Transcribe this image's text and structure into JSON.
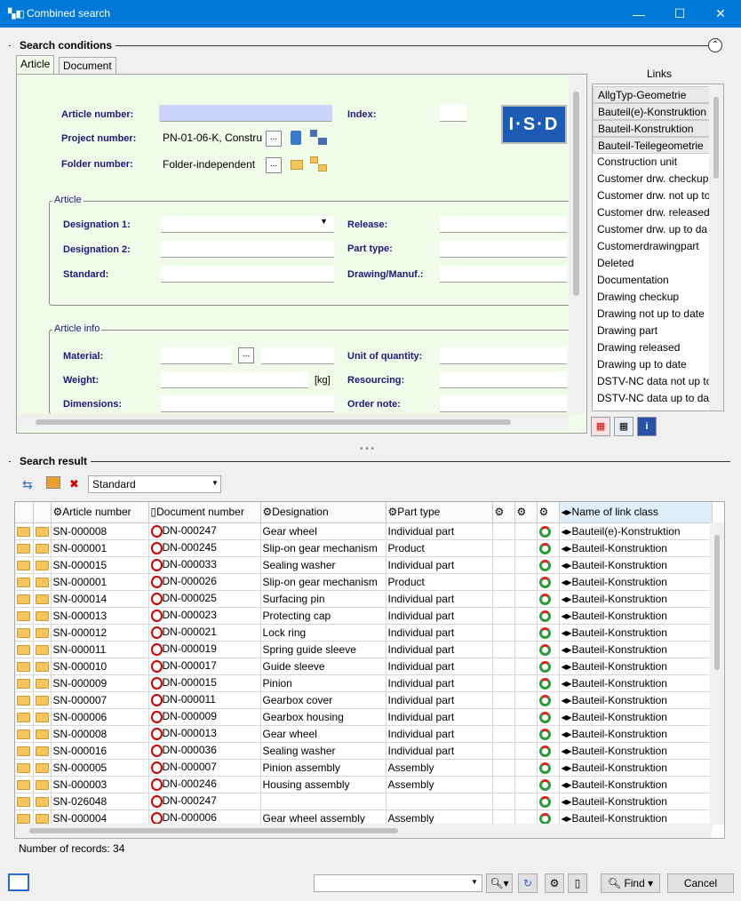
{
  "window": {
    "title": "Combined search",
    "app_icon": "isd-app-icon"
  },
  "search_conditions": {
    "title": "Search conditions",
    "tabs": [
      "Article",
      "Document"
    ],
    "article_number": {
      "label": "Article number:",
      "value": ""
    },
    "index": {
      "label": "Index:",
      "value": ""
    },
    "project_number": {
      "label": "Project number:",
      "value": "PN-01-06-K, Constru"
    },
    "folder_number": {
      "label": "Folder number:",
      "value": "Folder-independent"
    },
    "browse_label": "...",
    "logo_text": "I·S·D",
    "article_group": {
      "title": "Article",
      "designation1": {
        "label": "Designation 1:",
        "value": ""
      },
      "designation2": {
        "label": "Designation 2:",
        "value": ""
      },
      "standard": {
        "label": "Standard:",
        "value": ""
      },
      "release": {
        "label": "Release:",
        "value": ""
      },
      "part_type": {
        "label": "Part type:",
        "value": ""
      },
      "drawing_manuf": {
        "label": "Drawing/Manuf.:",
        "value": ""
      }
    },
    "article_info_group": {
      "title": "Article info",
      "material": {
        "label": "Material:",
        "value": ""
      },
      "weight": {
        "label": "Weight:",
        "value": "",
        "unit": "[kg]"
      },
      "dimensions": {
        "label": "Dimensions:",
        "value": ""
      },
      "unit_of_quantity": {
        "label": "Unit of quantity:",
        "value": ""
      },
      "resourcing": {
        "label": "Resourcing:",
        "value": ""
      },
      "order_note": {
        "label": "Order note:",
        "value": ""
      }
    }
  },
  "links": {
    "title": "Links",
    "items": [
      {
        "label": "AllgTyp-Geometrie",
        "selected": true
      },
      {
        "label": "Bauteil(e)-Konstruktion",
        "selected": true
      },
      {
        "label": "Bauteil-Konstruktion",
        "selected": true
      },
      {
        "label": "Bauteil-Teilegeometrie",
        "selected": true
      },
      {
        "label": "Construction unit",
        "selected": false
      },
      {
        "label": "Customer drw. checkup",
        "selected": false
      },
      {
        "label": "Customer drw. not up to",
        "selected": false
      },
      {
        "label": "Customer drw. released",
        "selected": false
      },
      {
        "label": "Customer drw. up to da",
        "selected": false
      },
      {
        "label": "Customerdrawingpart",
        "selected": false
      },
      {
        "label": "Deleted",
        "selected": false
      },
      {
        "label": "Documentation",
        "selected": false
      },
      {
        "label": "Drawing checkup",
        "selected": false
      },
      {
        "label": "Drawing not up to date",
        "selected": false
      },
      {
        "label": "Drawing part",
        "selected": false
      },
      {
        "label": "Drawing released",
        "selected": false
      },
      {
        "label": "Drawing up to date",
        "selected": false
      },
      {
        "label": "DSTV-NC data not up to",
        "selected": false
      },
      {
        "label": "DSTV-NC data up to dat",
        "selected": false
      }
    ]
  },
  "search_result": {
    "title": "Search result",
    "profile": "Standard",
    "columns": [
      "Article number",
      "Document number",
      "Designation",
      "Part type",
      "",
      "",
      "",
      "Name of link class"
    ],
    "rows": [
      {
        "article": "SN-000008",
        "document": "DN-000247",
        "designation": "Gear wheel",
        "part_type": "Individual part",
        "link": "Bauteil(e)-Konstruktion"
      },
      {
        "article": "SN-000001",
        "document": "DN-000245",
        "designation": "Slip-on gear mechanism",
        "part_type": "Product",
        "link": "Bauteil-Konstruktion"
      },
      {
        "article": "SN-000015",
        "document": "DN-000033",
        "designation": "Sealing washer",
        "part_type": "Individual part",
        "link": "Bauteil-Konstruktion"
      },
      {
        "article": "SN-000001",
        "document": "DN-000026",
        "designation": "Slip-on gear mechanism",
        "part_type": "Product",
        "link": "Bauteil-Konstruktion"
      },
      {
        "article": "SN-000014",
        "document": "DN-000025",
        "designation": "Surfacing pin",
        "part_type": "Individual part",
        "link": "Bauteil-Konstruktion"
      },
      {
        "article": "SN-000013",
        "document": "DN-000023",
        "designation": "Protecting cap",
        "part_type": "Individual part",
        "link": "Bauteil-Konstruktion"
      },
      {
        "article": "SN-000012",
        "document": "DN-000021",
        "designation": "Lock ring",
        "part_type": "Individual part",
        "link": "Bauteil-Konstruktion"
      },
      {
        "article": "SN-000011",
        "document": "DN-000019",
        "designation": "Spring guide sleeve",
        "part_type": "Individual part",
        "link": "Bauteil-Konstruktion"
      },
      {
        "article": "SN-000010",
        "document": "DN-000017",
        "designation": "Guide sleeve",
        "part_type": "Individual part",
        "link": "Bauteil-Konstruktion"
      },
      {
        "article": "SN-000009",
        "document": "DN-000015",
        "designation": "Pinion",
        "part_type": "Individual part",
        "link": "Bauteil-Konstruktion"
      },
      {
        "article": "SN-000007",
        "document": "DN-000011",
        "designation": "Gearbox cover",
        "part_type": "Individual part",
        "link": "Bauteil-Konstruktion"
      },
      {
        "article": "SN-000006",
        "document": "DN-000009",
        "designation": "Gearbox housing",
        "part_type": "Individual part",
        "link": "Bauteil-Konstruktion"
      },
      {
        "article": "SN-000008",
        "document": "DN-000013",
        "designation": "Gear wheel",
        "part_type": "Individual part",
        "link": "Bauteil-Konstruktion"
      },
      {
        "article": "SN-000016",
        "document": "DN-000036",
        "designation": "Sealing washer",
        "part_type": "Individual part",
        "link": "Bauteil-Konstruktion"
      },
      {
        "article": "SN-000005",
        "document": "DN-000007",
        "designation": "Pinion assembly",
        "part_type": "Assembly",
        "link": "Bauteil-Konstruktion"
      },
      {
        "article": "SN-000003",
        "document": "DN-000246",
        "designation": "Housing assembly",
        "part_type": "Assembly",
        "link": "Bauteil-Konstruktion"
      },
      {
        "article": "SN-026048",
        "document": "DN-000247",
        "designation": "",
        "part_type": "",
        "link": "Bauteil-Konstruktion"
      },
      {
        "article": "SN-000004",
        "document": "DN-000006",
        "designation": "Gear wheel assembly",
        "part_type": "Assembly",
        "link": "Bauteil-Konstruktion"
      }
    ],
    "record_count": "Number of records: 34"
  },
  "footer": {
    "find_label": "Find",
    "cancel_label": "Cancel",
    "dropdown_value": ""
  }
}
